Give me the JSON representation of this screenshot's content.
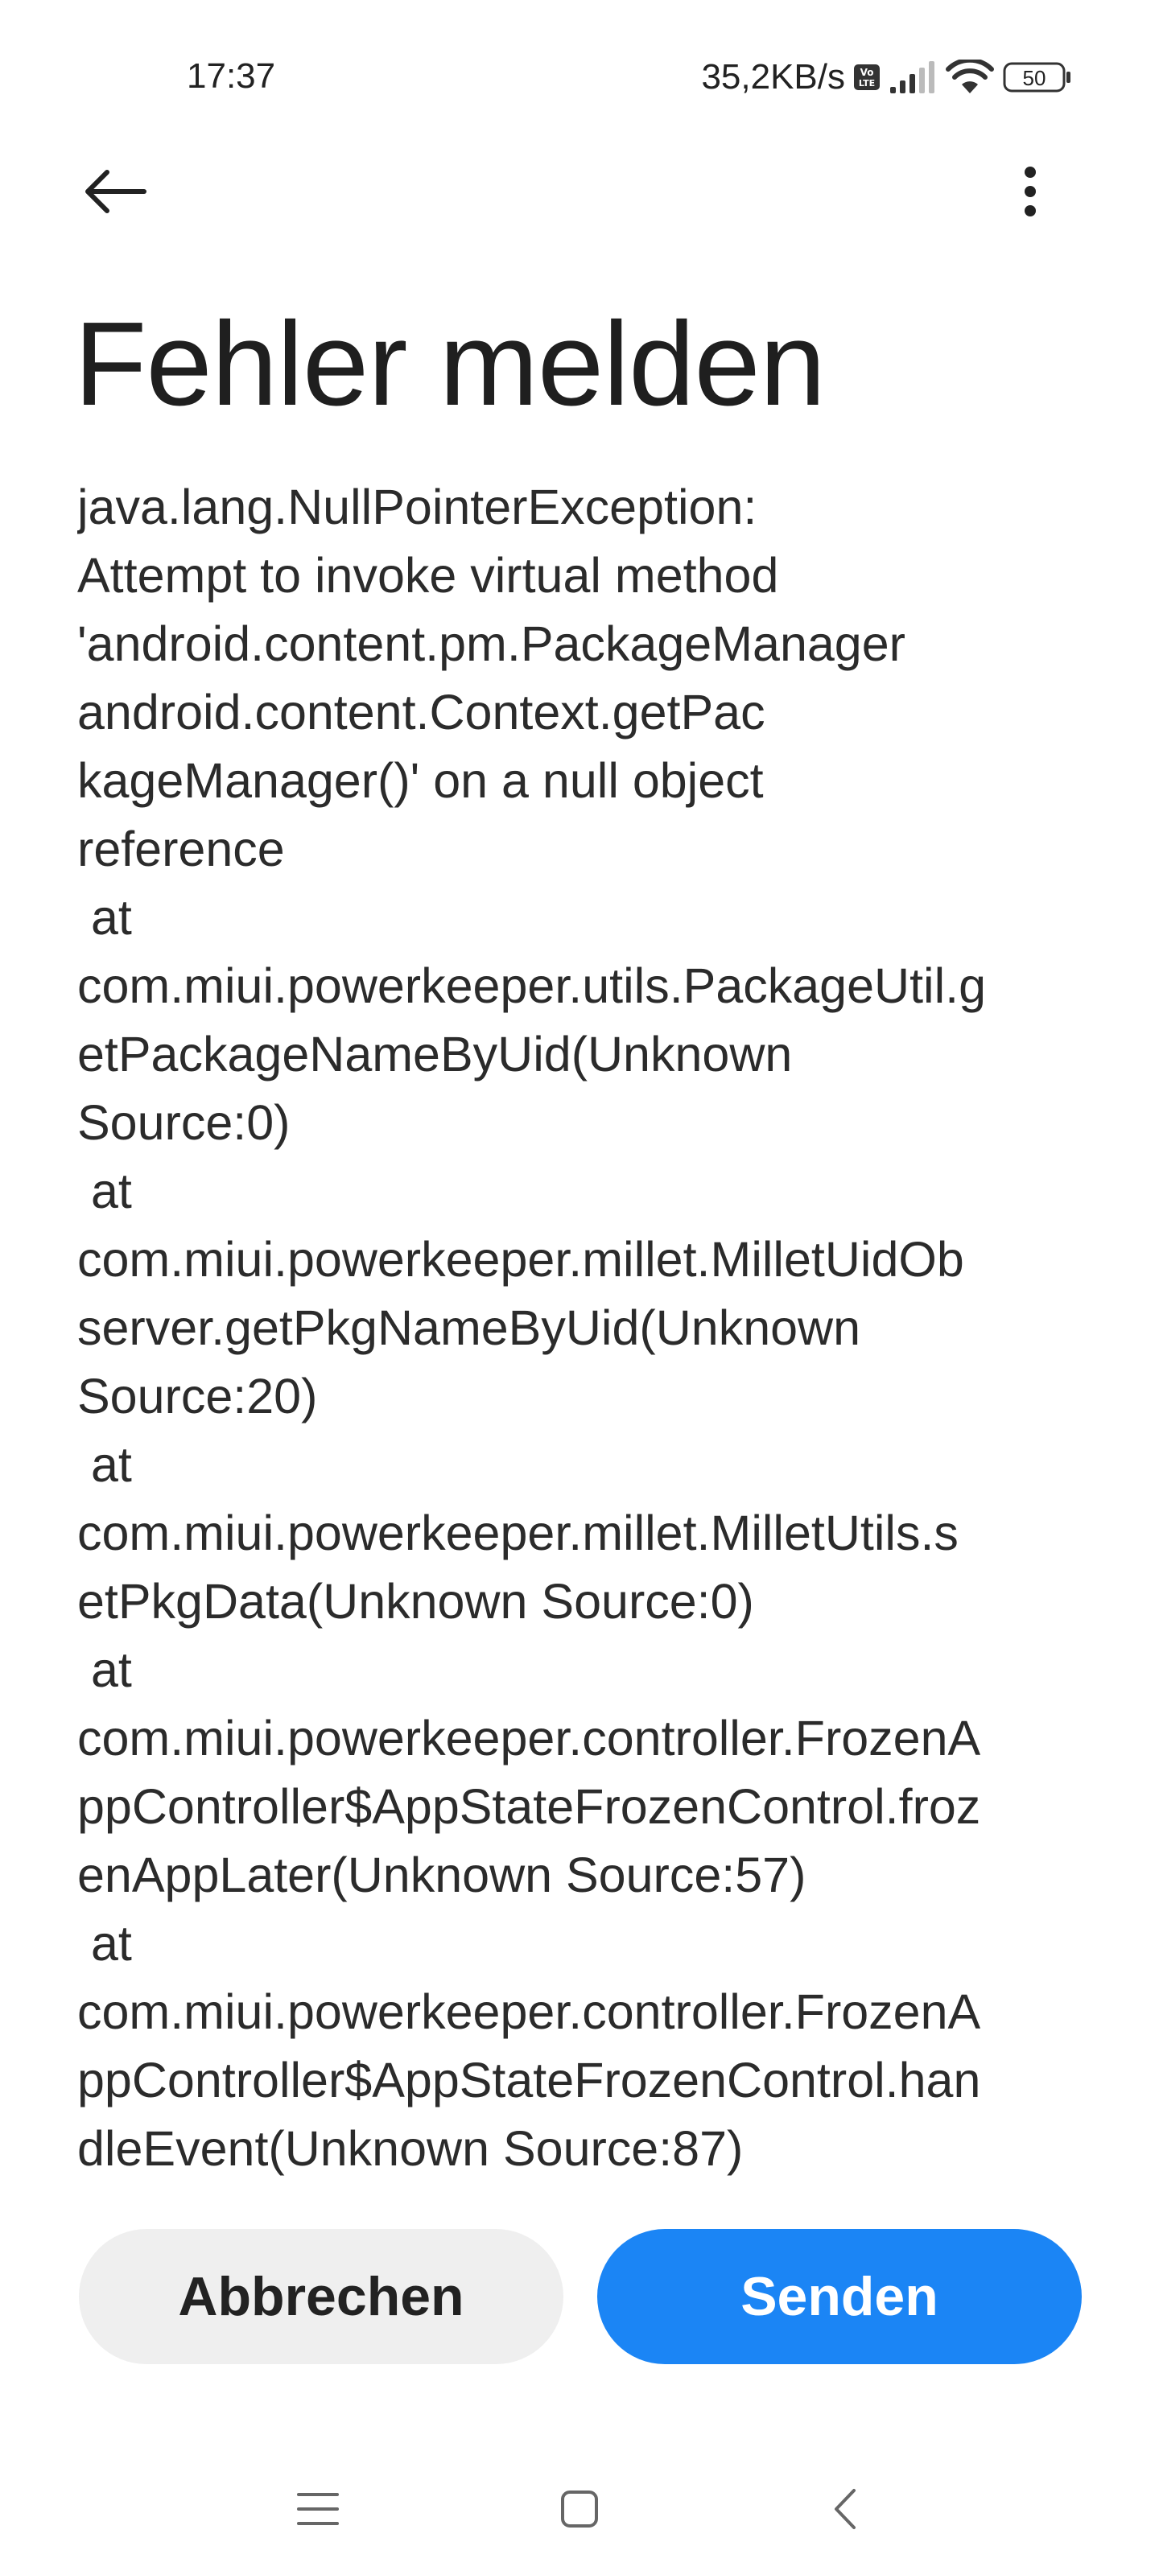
{
  "status_bar": {
    "time": "17:37",
    "network_speed": "35,2KB/s",
    "volte_badge": "VoLTE",
    "battery_level": "50",
    "icons": [
      "volte-icon",
      "signal-icon",
      "wifi-icon",
      "battery-icon"
    ]
  },
  "app_bar": {
    "back_icon": "arrow-left-icon",
    "more_icon": "more-vertical-icon"
  },
  "page": {
    "title": "Fehler melden",
    "error_lines": [
      "java.lang.NullPointerException:",
      "Attempt to invoke virtual method",
      "'android.content.pm.PackageManager",
      "android.content.Context.getPac",
      "kageManager()' on a null object",
      "reference",
      " at",
      "com.miui.powerkeeper.utils.PackageUtil.g",
      "etPackageNameByUid(Unknown",
      "Source:0)",
      " at",
      "com.miui.powerkeeper.millet.MilletUidOb",
      "server.getPkgNameByUid(Unknown",
      "Source:20)",
      " at",
      "com.miui.powerkeeper.millet.MilletUtils.s",
      "etPkgData(Unknown Source:0)",
      " at",
      "com.miui.powerkeeper.controller.FrozenA",
      "ppController$AppStateFrozenControl.froz",
      "enAppLater(Unknown Source:57)",
      " at",
      "com.miui.powerkeeper.controller.FrozenA",
      "ppController$AppStateFrozenControl.han",
      "dleEvent(Unknown Source:87)"
    ]
  },
  "actions": {
    "cancel_label": "Abbrechen",
    "send_label": "Senden"
  },
  "nav_bar": {
    "icons": [
      "menu-icon",
      "home-icon",
      "back-icon"
    ]
  },
  "colors": {
    "accent": "#1b85f5",
    "cancel_bg": "#efefef",
    "text": "#2b2b2b"
  }
}
